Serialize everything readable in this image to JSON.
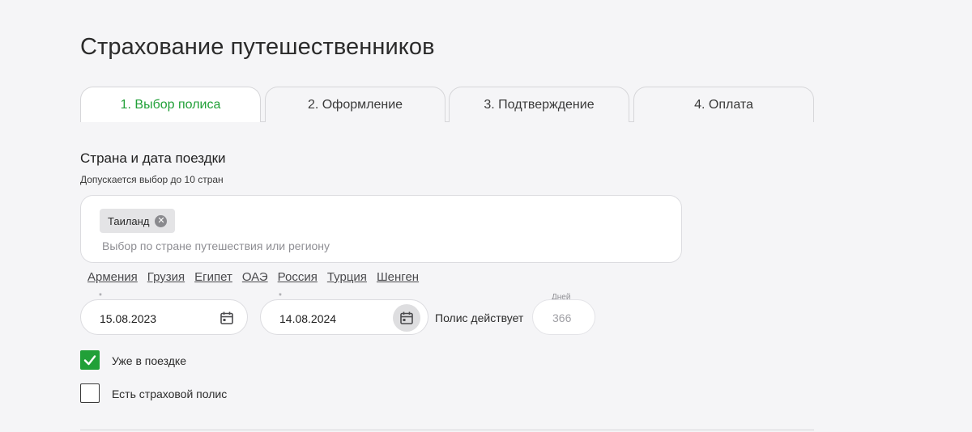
{
  "page_title": "Страхование путешественников",
  "tabs": [
    {
      "label": "1. Выбор полиса",
      "active": true
    },
    {
      "label": "2. Оформление",
      "active": false
    },
    {
      "label": "3. Подтверждение",
      "active": false
    },
    {
      "label": "4. Оплата",
      "active": false
    }
  ],
  "trip": {
    "section_title": "Страна и дата поездки",
    "hint": "Допускается выбор до 10 стран",
    "selected_countries": [
      "Таиланд"
    ],
    "chip_remove_glyph": "✕",
    "country_input": {
      "value": "",
      "placeholder": "Выбор по стране путешествия или региону"
    },
    "quick_links": [
      "Армения",
      "Грузия",
      "Египет",
      "ОАЭ",
      "Россия",
      "Турция",
      "Шенген"
    ]
  },
  "dates": {
    "required_mark": "*",
    "start": {
      "value": "15.08.2023"
    },
    "end": {
      "value": "14.08.2024"
    },
    "policy_label": "Полис действует",
    "days_label": "Дней",
    "days_value": "366"
  },
  "options": [
    {
      "label": "Уже в поездке",
      "checked": true
    },
    {
      "label": "Есть страховой полис",
      "checked": false
    }
  ],
  "colors": {
    "accent": "#21a038",
    "background": "#f5f5f7"
  },
  "icons": {
    "calendar": "calendar-icon",
    "check": "check-icon",
    "remove": "close-circle-icon"
  }
}
